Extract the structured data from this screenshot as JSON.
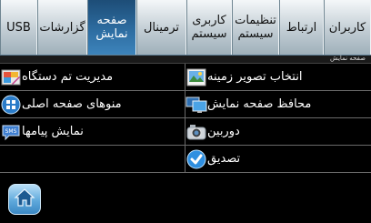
{
  "tabs": [
    {
      "label": "کاربران",
      "active": false
    },
    {
      "label": "ارتباط",
      "active": false
    },
    {
      "label": "تنظیمات\nسیستم",
      "active": false
    },
    {
      "label": "کاربری\nسیستم",
      "active": false
    },
    {
      "label": "ترمینال",
      "active": false
    },
    {
      "label": "صفحه\nنمایش",
      "active": true
    },
    {
      "label": "گزارشات",
      "active": false
    },
    {
      "label": "USB",
      "active": false
    }
  ],
  "section_title": "صفحه نمایش",
  "items": {
    "wallpaper": {
      "label": "انتخاب تصویر زمینه",
      "icon": "wallpaper-icon"
    },
    "screensaver": {
      "label": "محافظ صفحه نمایش",
      "icon": "monitors-icon"
    },
    "camera": {
      "label": "دوربین",
      "icon": "camera-icon"
    },
    "confirm": {
      "label": "تصدیق",
      "icon": "checkmark-icon"
    },
    "device_management": {
      "label": "مدیریت تم دستگاه",
      "icon": "theme-palette-icon"
    },
    "main_menus": {
      "label": "منوهای صفحه اصلی",
      "icon": "menu-icon"
    },
    "messages": {
      "label": "نمایش پیامها",
      "icon": "sms-icon"
    },
    "sms_badge": "SMS"
  },
  "colors": {
    "tab_active": "#2f6fa4",
    "tab_inactive": "#c2cdd4",
    "background": "#000000",
    "home_button": "#5fa9dc"
  }
}
